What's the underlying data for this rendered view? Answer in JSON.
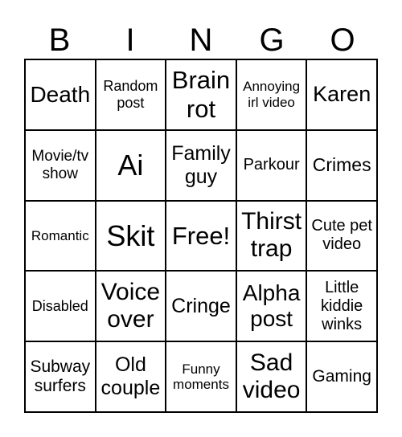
{
  "header": [
    "B",
    "I",
    "N",
    "G",
    "O"
  ],
  "cells": [
    "Death",
    "Random post",
    "Brain rot",
    "Annoying irl video",
    "Karen",
    "Movie/tv show",
    "Ai",
    "Family guy",
    "Parkour",
    "Crimes",
    "Romantic",
    "Skit",
    "Free!",
    "Thirst trap",
    "Cute pet video",
    "Disabled",
    "Voice over",
    "Cringe",
    "Alpha post",
    "Little kiddie winks",
    "Subway surfers",
    "Old couple",
    "Funny moments",
    "Sad video",
    "Gaming"
  ]
}
